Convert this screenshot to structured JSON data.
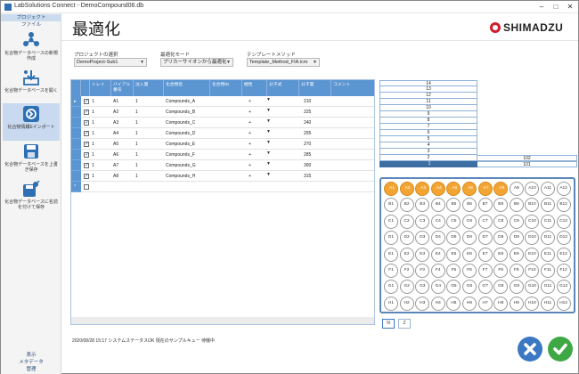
{
  "window": {
    "title": "LabSolutions Connect - DemoCompound06.db"
  },
  "sidebar": {
    "tabs": [
      {
        "label": "プロジェクト"
      },
      {
        "label": "ファイル"
      }
    ],
    "buttons": [
      {
        "label": "化合物データベースの新規作成",
        "icon": "new-database-icon"
      },
      {
        "label": "化合物データベースを開く",
        "icon": "open-database-icon"
      },
      {
        "label": "化合物情報Eインポート",
        "icon": "import-icon"
      },
      {
        "label": "化合物データベースを上書き保存",
        "icon": "save-database-icon"
      },
      {
        "label": "化合物データベースに名前を付けて保存",
        "icon": "save-as-icon"
      }
    ],
    "bottom_tabs": [
      {
        "label": "表示"
      },
      {
        "label": "メタデータ"
      },
      {
        "label": "管理"
      }
    ]
  },
  "header": {
    "title": "最適化",
    "logo_text": "SHIMADZU"
  },
  "selectors": {
    "project": {
      "label": "プロジェクトの選択",
      "value": "DemoProject-Sub1"
    },
    "mode": {
      "label": "最適化モード",
      "value": "プリカーサイオンから最適化"
    },
    "template": {
      "label": "テンプレートメソッド",
      "value": "Template_Method_FIA.lcm"
    }
  },
  "table": {
    "columns": [
      "",
      "トレイ",
      "バイアル番号",
      "注入量",
      "化合物名",
      "化合物ID",
      "極性",
      "分子式",
      "分子量",
      "コメント"
    ],
    "rows": [
      {
        "tray": "1",
        "vial": "A1",
        "vol": "1",
        "name": "Compounds_A",
        "polarity": "+",
        "mw": "210"
      },
      {
        "tray": "1",
        "vial": "A2",
        "vol": "1",
        "name": "Compounds_B",
        "polarity": "+",
        "mw": "225"
      },
      {
        "tray": "1",
        "vial": "A3",
        "vol": "1",
        "name": "Compounds_C",
        "polarity": "+",
        "mw": "240"
      },
      {
        "tray": "1",
        "vial": "A4",
        "vol": "1",
        "name": "Compounds_D",
        "polarity": "+",
        "mw": "255"
      },
      {
        "tray": "1",
        "vial": "A5",
        "vol": "1",
        "name": "Compounds_E",
        "polarity": "+",
        "mw": "270"
      },
      {
        "tray": "1",
        "vial": "A6",
        "vol": "1",
        "name": "Compounds_F",
        "polarity": "+",
        "mw": "285"
      },
      {
        "tray": "1",
        "vial": "A7",
        "vol": "1",
        "name": "Compounds_G",
        "polarity": "+",
        "mw": "300"
      },
      {
        "tray": "1",
        "vial": "A8",
        "vol": "1",
        "name": "Compounds_H",
        "polarity": "+",
        "mw": "315"
      }
    ]
  },
  "stack": {
    "rows": [
      {
        "label": "14",
        "value": ""
      },
      {
        "label": "13",
        "value": ""
      },
      {
        "label": "12",
        "value": ""
      },
      {
        "label": "11",
        "value": ""
      },
      {
        "label": "10",
        "value": ""
      },
      {
        "label": "9",
        "value": ""
      },
      {
        "label": "8",
        "value": ""
      },
      {
        "label": "7",
        "value": ""
      },
      {
        "label": "6",
        "value": ""
      },
      {
        "label": "5",
        "value": ""
      },
      {
        "label": "4",
        "value": ""
      },
      {
        "label": "3",
        "value": ""
      },
      {
        "label": "2",
        "value": "102"
      },
      {
        "label": "1",
        "value": "101"
      }
    ]
  },
  "plate": {
    "rows": [
      "A",
      "B",
      "C",
      "D",
      "E",
      "F",
      "G",
      "H"
    ],
    "cols": 12,
    "selected": [
      "A1",
      "A2",
      "A3",
      "A4",
      "A5",
      "A6",
      "A7",
      "A8"
    ],
    "selected_color": "#f3a533"
  },
  "nav": {
    "n_label": "N",
    "z_label": "Z"
  },
  "status": {
    "text": "2020/08/28 15:17 システムステータスOK 現在のサンプルキュー 待機中"
  },
  "colors": {
    "accent": "#5b95d2",
    "cancel": "#3a78c4",
    "ok": "#3ea845"
  }
}
